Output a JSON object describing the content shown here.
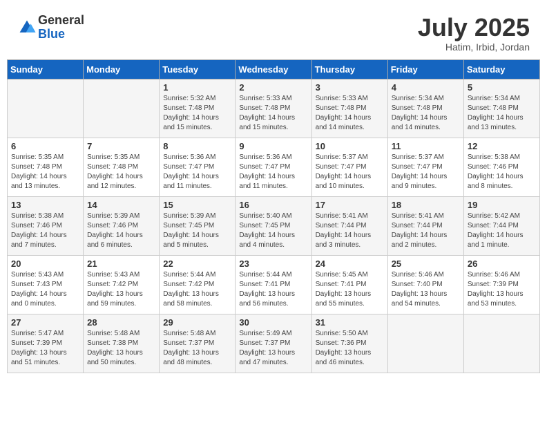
{
  "header": {
    "logo_general": "General",
    "logo_blue": "Blue",
    "month": "July 2025",
    "location": "Hatim, Irbid, Jordan"
  },
  "weekdays": [
    "Sunday",
    "Monday",
    "Tuesday",
    "Wednesday",
    "Thursday",
    "Friday",
    "Saturday"
  ],
  "weeks": [
    [
      {
        "day": "",
        "info": ""
      },
      {
        "day": "",
        "info": ""
      },
      {
        "day": "1",
        "info": "Sunrise: 5:32 AM\nSunset: 7:48 PM\nDaylight: 14 hours and 15 minutes."
      },
      {
        "day": "2",
        "info": "Sunrise: 5:33 AM\nSunset: 7:48 PM\nDaylight: 14 hours and 15 minutes."
      },
      {
        "day": "3",
        "info": "Sunrise: 5:33 AM\nSunset: 7:48 PM\nDaylight: 14 hours and 14 minutes."
      },
      {
        "day": "4",
        "info": "Sunrise: 5:34 AM\nSunset: 7:48 PM\nDaylight: 14 hours and 14 minutes."
      },
      {
        "day": "5",
        "info": "Sunrise: 5:34 AM\nSunset: 7:48 PM\nDaylight: 14 hours and 13 minutes."
      }
    ],
    [
      {
        "day": "6",
        "info": "Sunrise: 5:35 AM\nSunset: 7:48 PM\nDaylight: 14 hours and 13 minutes."
      },
      {
        "day": "7",
        "info": "Sunrise: 5:35 AM\nSunset: 7:48 PM\nDaylight: 14 hours and 12 minutes."
      },
      {
        "day": "8",
        "info": "Sunrise: 5:36 AM\nSunset: 7:47 PM\nDaylight: 14 hours and 11 minutes."
      },
      {
        "day": "9",
        "info": "Sunrise: 5:36 AM\nSunset: 7:47 PM\nDaylight: 14 hours and 11 minutes."
      },
      {
        "day": "10",
        "info": "Sunrise: 5:37 AM\nSunset: 7:47 PM\nDaylight: 14 hours and 10 minutes."
      },
      {
        "day": "11",
        "info": "Sunrise: 5:37 AM\nSunset: 7:47 PM\nDaylight: 14 hours and 9 minutes."
      },
      {
        "day": "12",
        "info": "Sunrise: 5:38 AM\nSunset: 7:46 PM\nDaylight: 14 hours and 8 minutes."
      }
    ],
    [
      {
        "day": "13",
        "info": "Sunrise: 5:38 AM\nSunset: 7:46 PM\nDaylight: 14 hours and 7 minutes."
      },
      {
        "day": "14",
        "info": "Sunrise: 5:39 AM\nSunset: 7:46 PM\nDaylight: 14 hours and 6 minutes."
      },
      {
        "day": "15",
        "info": "Sunrise: 5:39 AM\nSunset: 7:45 PM\nDaylight: 14 hours and 5 minutes."
      },
      {
        "day": "16",
        "info": "Sunrise: 5:40 AM\nSunset: 7:45 PM\nDaylight: 14 hours and 4 minutes."
      },
      {
        "day": "17",
        "info": "Sunrise: 5:41 AM\nSunset: 7:44 PM\nDaylight: 14 hours and 3 minutes."
      },
      {
        "day": "18",
        "info": "Sunrise: 5:41 AM\nSunset: 7:44 PM\nDaylight: 14 hours and 2 minutes."
      },
      {
        "day": "19",
        "info": "Sunrise: 5:42 AM\nSunset: 7:44 PM\nDaylight: 14 hours and 1 minute."
      }
    ],
    [
      {
        "day": "20",
        "info": "Sunrise: 5:43 AM\nSunset: 7:43 PM\nDaylight: 14 hours and 0 minutes."
      },
      {
        "day": "21",
        "info": "Sunrise: 5:43 AM\nSunset: 7:42 PM\nDaylight: 13 hours and 59 minutes."
      },
      {
        "day": "22",
        "info": "Sunrise: 5:44 AM\nSunset: 7:42 PM\nDaylight: 13 hours and 58 minutes."
      },
      {
        "day": "23",
        "info": "Sunrise: 5:44 AM\nSunset: 7:41 PM\nDaylight: 13 hours and 56 minutes."
      },
      {
        "day": "24",
        "info": "Sunrise: 5:45 AM\nSunset: 7:41 PM\nDaylight: 13 hours and 55 minutes."
      },
      {
        "day": "25",
        "info": "Sunrise: 5:46 AM\nSunset: 7:40 PM\nDaylight: 13 hours and 54 minutes."
      },
      {
        "day": "26",
        "info": "Sunrise: 5:46 AM\nSunset: 7:39 PM\nDaylight: 13 hours and 53 minutes."
      }
    ],
    [
      {
        "day": "27",
        "info": "Sunrise: 5:47 AM\nSunset: 7:39 PM\nDaylight: 13 hours and 51 minutes."
      },
      {
        "day": "28",
        "info": "Sunrise: 5:48 AM\nSunset: 7:38 PM\nDaylight: 13 hours and 50 minutes."
      },
      {
        "day": "29",
        "info": "Sunrise: 5:48 AM\nSunset: 7:37 PM\nDaylight: 13 hours and 48 minutes."
      },
      {
        "day": "30",
        "info": "Sunrise: 5:49 AM\nSunset: 7:37 PM\nDaylight: 13 hours and 47 minutes."
      },
      {
        "day": "31",
        "info": "Sunrise: 5:50 AM\nSunset: 7:36 PM\nDaylight: 13 hours and 46 minutes."
      },
      {
        "day": "",
        "info": ""
      },
      {
        "day": "",
        "info": ""
      }
    ]
  ]
}
